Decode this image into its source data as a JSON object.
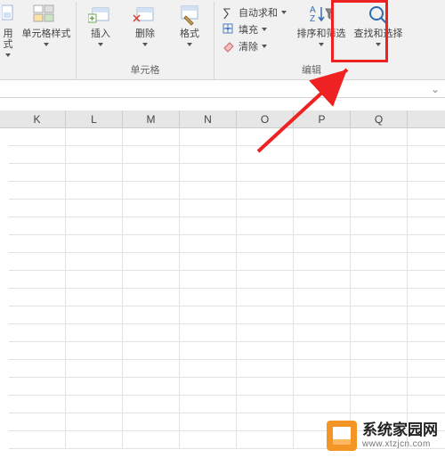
{
  "ribbon": {
    "styles_group": {
      "apply_style": "用式",
      "cell_styles": "单元格样式"
    },
    "cells_group": {
      "insert": "插入",
      "delete": "删除",
      "format": "格式",
      "label": "单元格"
    },
    "editing_group": {
      "autosum": "自动求和",
      "fill": "填充",
      "clear": "清除",
      "sort_filter": "排序和筛选",
      "find_select": "查找和选择",
      "label": "编辑"
    }
  },
  "columns": [
    "K",
    "L",
    "M",
    "N",
    "O",
    "P",
    "Q"
  ],
  "watermark": {
    "title": "系统家园网",
    "url": "www.xtzjcn.com"
  },
  "chart_data": {
    "type": "table",
    "columns": [
      "K",
      "L",
      "M",
      "N",
      "O",
      "P",
      "Q"
    ],
    "rows": [],
    "note": "Empty Excel worksheet grid, no cell values visible"
  }
}
